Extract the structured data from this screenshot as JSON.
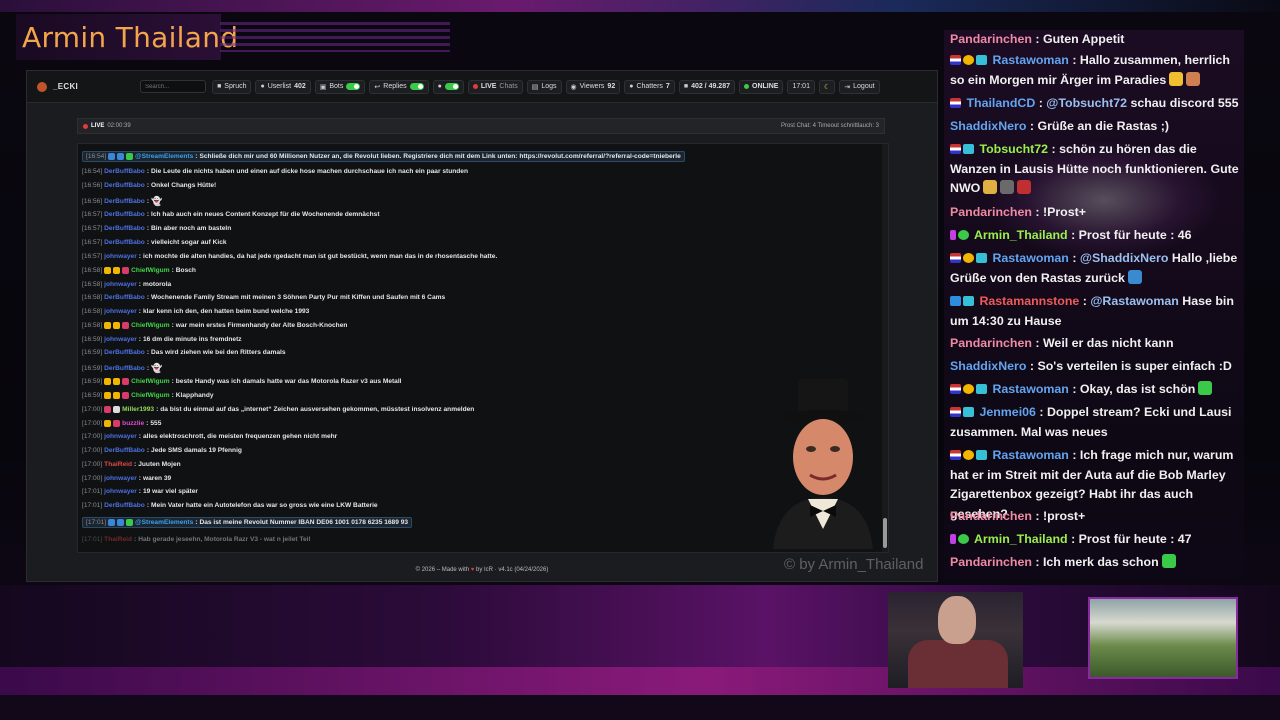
{
  "overlay": {
    "brand": "Armin Thailand",
    "watermark": "© by Armin_Thailand"
  },
  "app": {
    "title": "_ECKI",
    "search_placeholder": "Search...",
    "nav": {
      "spruch": "Spruch",
      "userlist": "Userlist",
      "userlist_count": "402",
      "bots": "Bots",
      "replies": "Replies",
      "live": "LIVE",
      "chats": "Chats",
      "logs": "Logs",
      "viewers": "Viewers",
      "viewers_count": "92",
      "chatters": "Chatters",
      "chatters_count": "7",
      "messages": "402 / 49.287",
      "online": "ONLINE",
      "time": "17:01",
      "logout": "Logout"
    },
    "status": {
      "live": "LIVE",
      "duration": "02:00:39",
      "right": "Prost Chat: 4   Timeout schnittlauch: 3"
    },
    "footer": {
      "pre": "© 2026 – Made with",
      "post": "by IcR · v4.1c (04/24/2026)"
    }
  },
  "chat": [
    {
      "ts": "[16:54]",
      "user": "@StreamElements",
      "cls": "u-teal",
      "text": "Schließe dich mir und 60 Millionen Nutzer an, die Revolut lieben. Registriere dich mit dem Link unten: https://revolut.com/referral/?referral-code=tnieberle",
      "hl": true,
      "badges": [
        "b-b",
        "b-b",
        "b-g"
      ]
    },
    {
      "ts": "[16:54]",
      "user": "DerBuffBabo",
      "cls": "u-blue",
      "text": "Die Leute die nichts haben und einen auf dicke hose machen durchschaue ich nach ein paar stunden"
    },
    {
      "ts": "[16:56]",
      "user": "DerBuffBabo",
      "cls": "u-blue",
      "text": "Onkel Changs Hütte!"
    },
    {
      "ts": "[16:56]",
      "user": "DerBuffBabo",
      "cls": "u-blue",
      "text": "",
      "ghost": true
    },
    {
      "ts": "[16:57]",
      "user": "DerBuffBabo",
      "cls": "u-blue",
      "text": "Ich hab auch ein neues Content Konzept für die Wochenende demnächst"
    },
    {
      "ts": "[16:57]",
      "user": "DerBuffBabo",
      "cls": "u-blue",
      "text": "Bin aber noch am basteln"
    },
    {
      "ts": "[16:57]",
      "user": "DerBuffBabo",
      "cls": "u-blue",
      "text": "vielleicht sogar auf Kick"
    },
    {
      "ts": "[16:57]",
      "user": "johnwayer",
      "cls": "u-blue",
      "text": "ich mochte die alten handies, da hat jede rgedacht man ist gut bestückt, wenn man das in de rhosentasche hatte."
    },
    {
      "ts": "[16:58]",
      "user": "ChiefWigum",
      "cls": "u-green",
      "text": "Bosch",
      "badges": [
        "b-y",
        "b-y",
        "b-r"
      ]
    },
    {
      "ts": "[16:58]",
      "user": "johnwayer",
      "cls": "u-blue",
      "text": "motorola"
    },
    {
      "ts": "[16:58]",
      "user": "DerBuffBabo",
      "cls": "u-blue",
      "text": "Wochenende Family Stream mit meinen 3 Söhnen Party Pur mit Kiffen und Saufen mit 6 Cams"
    },
    {
      "ts": "[16:58]",
      "user": "johnwayer",
      "cls": "u-blue",
      "text": "klar kenn ich den, den hatten beim bund welche 1993"
    },
    {
      "ts": "[16:58]",
      "user": "ChiefWigum",
      "cls": "u-green",
      "text": "war mein erstes Firmenhandy der Alte Bosch-Knochen",
      "badges": [
        "b-y",
        "b-y",
        "b-r"
      ]
    },
    {
      "ts": "[16:59]",
      "user": "johnwayer",
      "cls": "u-blue",
      "text": "16 dm die minute ins fremdnetz"
    },
    {
      "ts": "[16:59]",
      "user": "DerBuffBabo",
      "cls": "u-blue",
      "text": "Das wird ziehen wie bei den Ritters damals"
    },
    {
      "ts": "[16:59]",
      "user": "DerBuffBabo",
      "cls": "u-blue",
      "text": "",
      "ghost": true
    },
    {
      "ts": "[16:59]",
      "user": "ChiefWigum",
      "cls": "u-green",
      "text": "beste Handy was ich damals hatte war das Motorola Razer v3 aus Metall",
      "badges": [
        "b-y",
        "b-y",
        "b-r"
      ]
    },
    {
      "ts": "[16:59]",
      "user": "ChiefWigum",
      "cls": "u-green",
      "text": "Klapphandy",
      "badges": [
        "b-y",
        "b-y",
        "b-r"
      ]
    },
    {
      "ts": "[17:00]",
      "user": "Miller1993",
      "cls": "u-lime",
      "text": "da bist du einmal auf das „internet“ Zeichen ausversehen gekommen, müsstest insolvenz anmelden",
      "badges": [
        "b-r",
        "b-w"
      ]
    },
    {
      "ts": "[17:00]",
      "user": "buzzlie",
      "cls": "u-pink",
      "text": "555",
      "badges": [
        "b-y",
        "b-r"
      ]
    },
    {
      "ts": "[17:00]",
      "user": "johnwayer",
      "cls": "u-blue",
      "text": "alles elektroschrott, die meisten frequenzen gehen nicht mehr"
    },
    {
      "ts": "[17:00]",
      "user": "DerBuffBabo",
      "cls": "u-blue",
      "text": "Jede SMS damals 19 Pfennig"
    },
    {
      "ts": "[17:00]",
      "user": "ThaiReid",
      "cls": "u-red",
      "text": "Juuten Mojen"
    },
    {
      "ts": "[17:00]",
      "user": "johnwayer",
      "cls": "u-blue",
      "text": "waren 39"
    },
    {
      "ts": "[17:01]",
      "user": "johnwayer",
      "cls": "u-blue",
      "text": "19 war viel später"
    },
    {
      "ts": "[17:01]",
      "user": "DerBuffBabo",
      "cls": "u-blue",
      "text": "Mein Vater hatte ein Autotelefon das war so gross wie eine LKW Batterie"
    },
    {
      "ts": "[17:01]",
      "user": "@StreamElements",
      "cls": "u-teal",
      "text": "Das ist meine Revolut Nummer IBAN DE06 1001 0178 6235 1689 93",
      "hl": true,
      "badges": [
        "b-b",
        "b-b",
        "b-g"
      ]
    },
    {
      "ts": "[17:01]",
      "user": "ThaiReid",
      "cls": "u-red",
      "text": "Hab gerade jeseehn, Motorola Razr V3 - wat n jeilet Teil",
      "dim": true
    }
  ],
  "side_chat": [
    {
      "user": "Pandarinchen",
      "cls": "n-pink",
      "text": "Guten Appetit",
      "badges": []
    },
    {
      "user": "Rastawoman",
      "cls": "n-blue",
      "text": "Hallo zusammen, herrlich so ein Morgen mir Ärger im Paradies",
      "badges": [
        "sb-flag",
        "sb-y",
        "sb-t"
      ],
      "emo": [
        "#f0c030",
        "#d08050"
      ]
    },
    {
      "user": "ThailandCD",
      "cls": "n-blue",
      "mention": "@Tobsucht72",
      "text": "schau discord 555",
      "badges": [
        "sb-flag"
      ]
    },
    {
      "user": "ShaddixNero",
      "cls": "n-blue",
      "text": "Grüße an die Rastas ;)",
      "badges": []
    },
    {
      "user": "Tobsucht72",
      "cls": "n-lime",
      "text": "schön zu hören das die Wanzen in Lausis Hütte noch funktionieren. Gute NWO",
      "badges": [
        "sb-flag",
        "sb-t"
      ],
      "emo": [
        "#e0b040",
        "#6a6a6a",
        "#c03030"
      ]
    },
    {
      "user": "Pandarinchen",
      "cls": "n-pink",
      "text": "!Prost+",
      "badges": []
    },
    {
      "user": "Armin_Thailand",
      "cls": "n-lime",
      "text": "Prost für heute : 46",
      "badges": [
        "sb-p",
        "sb-g"
      ]
    },
    {
      "user": "Rastawoman",
      "cls": "n-blue",
      "mention": "@ShaddixNero",
      "text": "Hallo ,liebe Grüße von den Rastas zurück",
      "badges": [
        "sb-flag",
        "sb-y",
        "sb-t"
      ],
      "emo": [
        "#3a8ad0"
      ]
    },
    {
      "user": "Rastamannstone",
      "cls": "n-red",
      "mention": "@Rastawoman",
      "text": "Hase bin um 14:30 zu Hause",
      "badges": [
        "sb-b",
        "sb-t"
      ]
    },
    {
      "user": "Pandarinchen",
      "cls": "n-pink",
      "text": "Weil er das nicht kann",
      "badges": []
    },
    {
      "user": "ShaddixNero",
      "cls": "n-blue",
      "text": "So's verteilen is super einfach :D",
      "badges": []
    },
    {
      "user": "Rastawoman",
      "cls": "n-blue",
      "text": "Okay, das ist schön",
      "badges": [
        "sb-flag",
        "sb-y",
        "sb-t"
      ],
      "emo": [
        "#3bc94a"
      ]
    },
    {
      "user": "Jenmei06",
      "cls": "n-blue",
      "text": "Doppel stream? Ecki und Lausi zusammen. Mal was neues",
      "badges": [
        "sb-flag",
        "sb-t"
      ]
    },
    {
      "user": "Rastawoman",
      "cls": "n-blue",
      "text": "Ich frage mich nur, warum hat er im Streit mit der Auta auf die Bob Marley Zigarettenbox gezeigt? Habt ihr das auch gesehen?",
      "badges": [
        "sb-flag",
        "sb-y",
        "sb-t"
      ]
    },
    {
      "user": "Pandarinchen",
      "cls": "n-pink",
      "text": "!prost+",
      "badges": []
    },
    {
      "user": "Armin_Thailand",
      "cls": "n-lime",
      "text": "Prost für heute : 47",
      "badges": [
        "sb-p",
        "sb-g"
      ]
    },
    {
      "user": "Pandarinchen",
      "cls": "n-pink",
      "text": "Ich merk das schon",
      "badges": [],
      "emo": [
        "#3bc94a"
      ]
    }
  ],
  "colors": {
    "accent": "#f2a54a",
    "live": "#e23b3b",
    "online": "#3bc94a"
  }
}
